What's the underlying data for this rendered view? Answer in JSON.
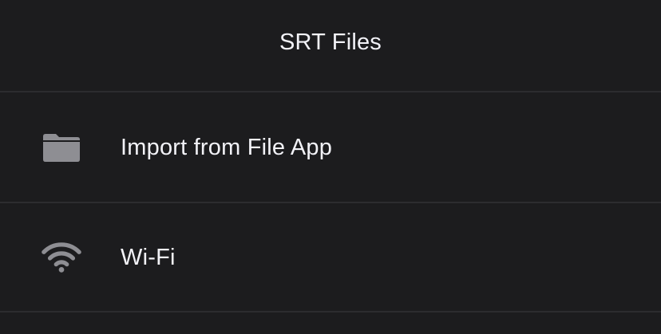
{
  "header": {
    "title": "SRT Files"
  },
  "menu": {
    "items": [
      {
        "label": "Import from File App",
        "icon": "folder-icon"
      },
      {
        "label": "Wi-Fi",
        "icon": "wifi-icon"
      }
    ]
  },
  "colors": {
    "background": "#1c1c1e",
    "text": "#f2f2f7",
    "icon": "#8e8e93",
    "separator": "#2c2c2f"
  }
}
